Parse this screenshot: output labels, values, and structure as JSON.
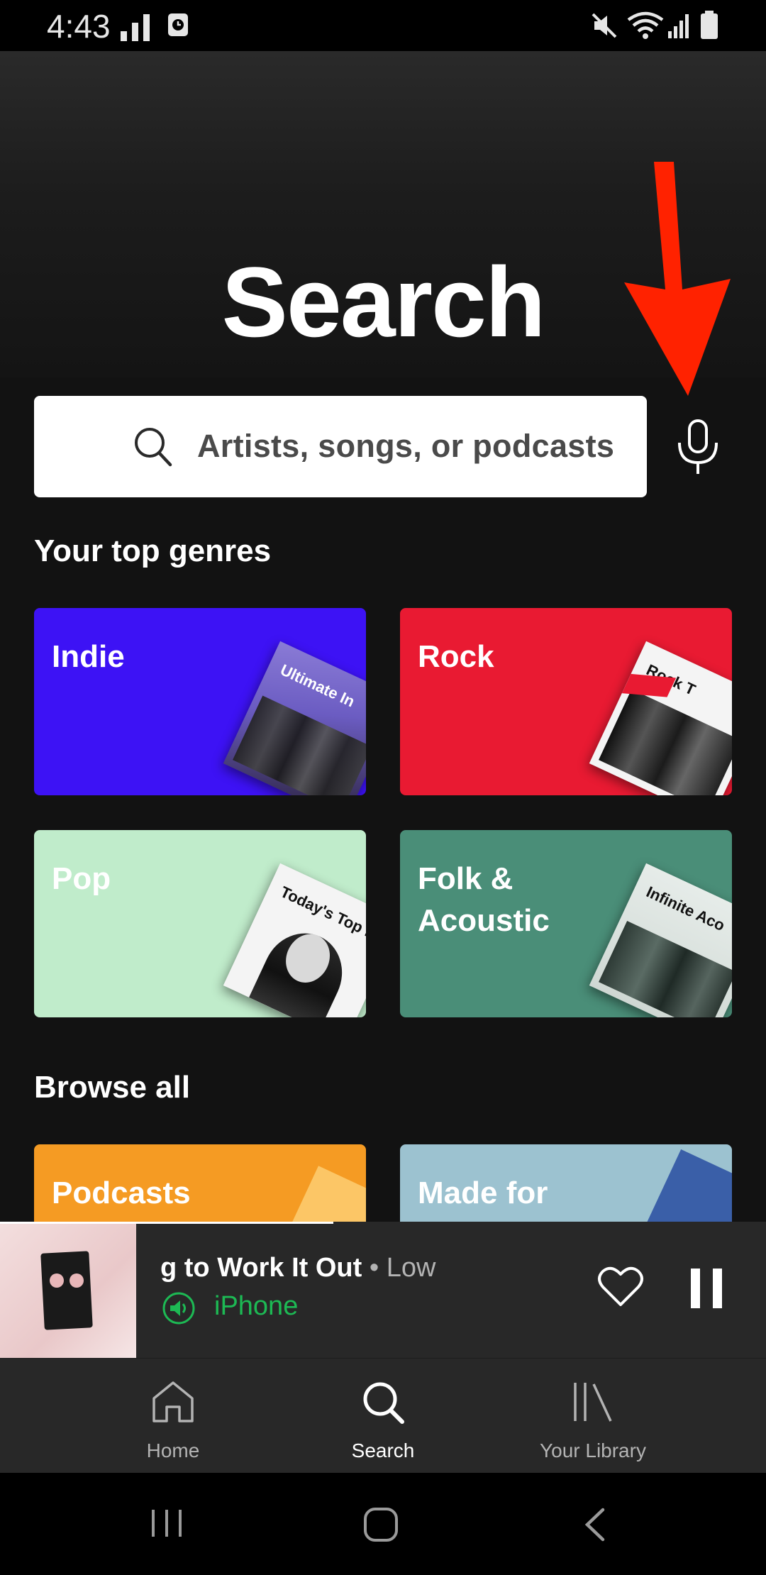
{
  "status_bar": {
    "time": "4:43",
    "icons": [
      "signal-bars-icon",
      "alarm-icon",
      "mute-icon",
      "wifi-icon",
      "cell-signal-icon",
      "battery-icon"
    ]
  },
  "page": {
    "title": "Search"
  },
  "search": {
    "placeholder": "Artists, songs, or podcasts",
    "icon": "search-icon",
    "voice_icon": "microphone-icon"
  },
  "annotation": {
    "arrow_color": "#ff2200"
  },
  "top_genres": {
    "heading": "Your top genres",
    "tiles": [
      {
        "label": "Indie",
        "color": "#3d12f5",
        "art_text": "Ultimate In"
      },
      {
        "label": "Rock",
        "color": "#e91a32",
        "art_text": "Rock T"
      },
      {
        "label": "Pop",
        "color": "#c0eccb",
        "art_text": "Today's Top H"
      },
      {
        "label": "Folk & Acoustic",
        "color": "#4a8e78",
        "art_text": "Infinite Aco"
      }
    ]
  },
  "browse_all": {
    "heading": "Browse all",
    "tiles": [
      {
        "label": "Podcasts",
        "color": "#f59b23"
      },
      {
        "label": "Made for",
        "color": "#9cc2d0"
      }
    ]
  },
  "now_playing": {
    "title": "g to Work It Out",
    "separator": "•",
    "artist": "Low",
    "device": "iPhone",
    "accent": "#1db954"
  },
  "bottom_nav": {
    "items": [
      {
        "label": "Home",
        "icon": "home-icon"
      },
      {
        "label": "Search",
        "icon": "search-icon"
      },
      {
        "label": "Your Library",
        "icon": "library-icon"
      }
    ]
  }
}
